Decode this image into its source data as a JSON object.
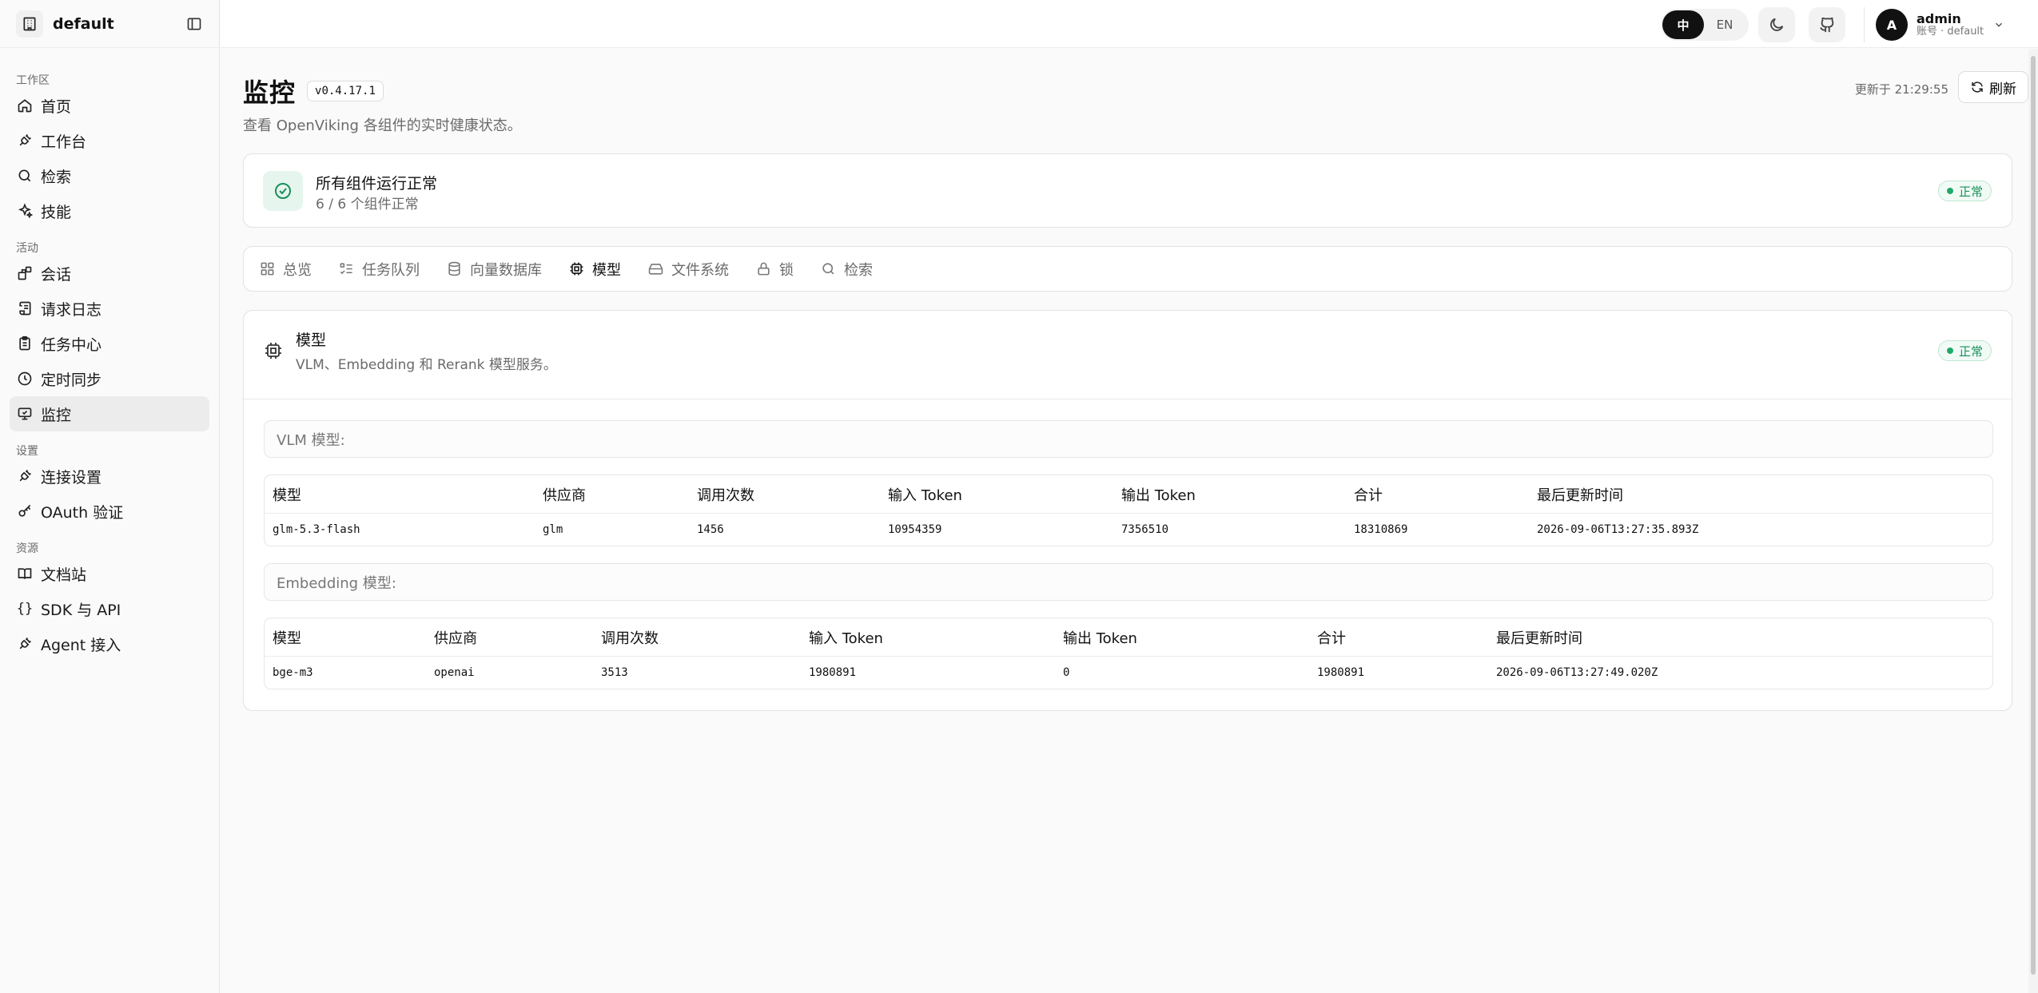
{
  "sidebar": {
    "workspace_name": "default",
    "groups": [
      {
        "label": "工作区",
        "items": [
          {
            "label": "首页",
            "icon": "home-icon"
          },
          {
            "label": "工作台",
            "icon": "plug-icon"
          },
          {
            "label": "检索",
            "icon": "search-icon"
          },
          {
            "label": "技能",
            "icon": "sparkles-icon"
          }
        ]
      },
      {
        "label": "活动",
        "items": [
          {
            "label": "会话",
            "icon": "blocks-icon"
          },
          {
            "label": "请求日志",
            "icon": "scroll-icon"
          },
          {
            "label": "任务中心",
            "icon": "clipboard-icon"
          },
          {
            "label": "定时同步",
            "icon": "clock-icon"
          },
          {
            "label": "监控",
            "icon": "monitor-icon",
            "active": true
          }
        ]
      },
      {
        "label": "设置",
        "items": [
          {
            "label": "连接设置",
            "icon": "plug-icon"
          },
          {
            "label": "OAuth 验证",
            "icon": "key-icon"
          }
        ]
      },
      {
        "label": "资源",
        "items": [
          {
            "label": "文档站",
            "icon": "book-icon"
          },
          {
            "label": "SDK 与 API",
            "icon": "braces-icon"
          },
          {
            "label": "Agent 接入",
            "icon": "plug-icon"
          }
        ]
      }
    ]
  },
  "topbar": {
    "lang_zh": "中",
    "lang_en": "EN",
    "user_name": "admin",
    "user_sub": "账号 · default",
    "avatar_letter": "A"
  },
  "page": {
    "title": "监控",
    "version": "v0.4.17.1",
    "subtitle": "查看 OpenViking 各组件的实时健康状态。",
    "updated": "更新于 21:29:55",
    "refresh_label": "刷新"
  },
  "summary": {
    "title": "所有组件运行正常",
    "subtitle": "6 / 6 个组件正常",
    "status": "正常"
  },
  "tabs": [
    {
      "label": "总览",
      "icon": "grid-icon"
    },
    {
      "label": "任务队列",
      "icon": "list-todo-icon"
    },
    {
      "label": "向量数据库",
      "icon": "database-icon"
    },
    {
      "label": "模型",
      "icon": "cpu-icon",
      "active": true
    },
    {
      "label": "文件系统",
      "icon": "hard-drive-icon"
    },
    {
      "label": "锁",
      "icon": "lock-icon"
    },
    {
      "label": "检索",
      "icon": "search-icon"
    }
  ],
  "model_panel": {
    "title": "模型",
    "subtitle": "VLM、Embedding 和 Rerank 模型服务。",
    "status": "正常",
    "vlm": {
      "label": "VLM 模型:",
      "columns": [
        "模型",
        "供应商",
        "调用次数",
        "输入 Token",
        "输出 Token",
        "合计",
        "最后更新时间"
      ],
      "rows": [
        [
          "glm-5.3-flash",
          "glm",
          "1456",
          "10954359",
          "7356510",
          "18310869",
          "2026-09-06T13:27:35.893Z"
        ]
      ]
    },
    "embedding": {
      "label": "Embedding 模型:",
      "columns": [
        "模型",
        "供应商",
        "调用次数",
        "输入 Token",
        "输出 Token",
        "合计",
        "最后更新时间"
      ],
      "rows": [
        [
          "bge-m3",
          "openai",
          "3513",
          "1980891",
          "0",
          "1980891",
          "2026-09-06T13:27:49.020Z"
        ]
      ]
    }
  },
  "colors": {
    "accent": "#111111",
    "status_ok": "#22a86a",
    "status_ok_bg": "#f1fbf6"
  }
}
